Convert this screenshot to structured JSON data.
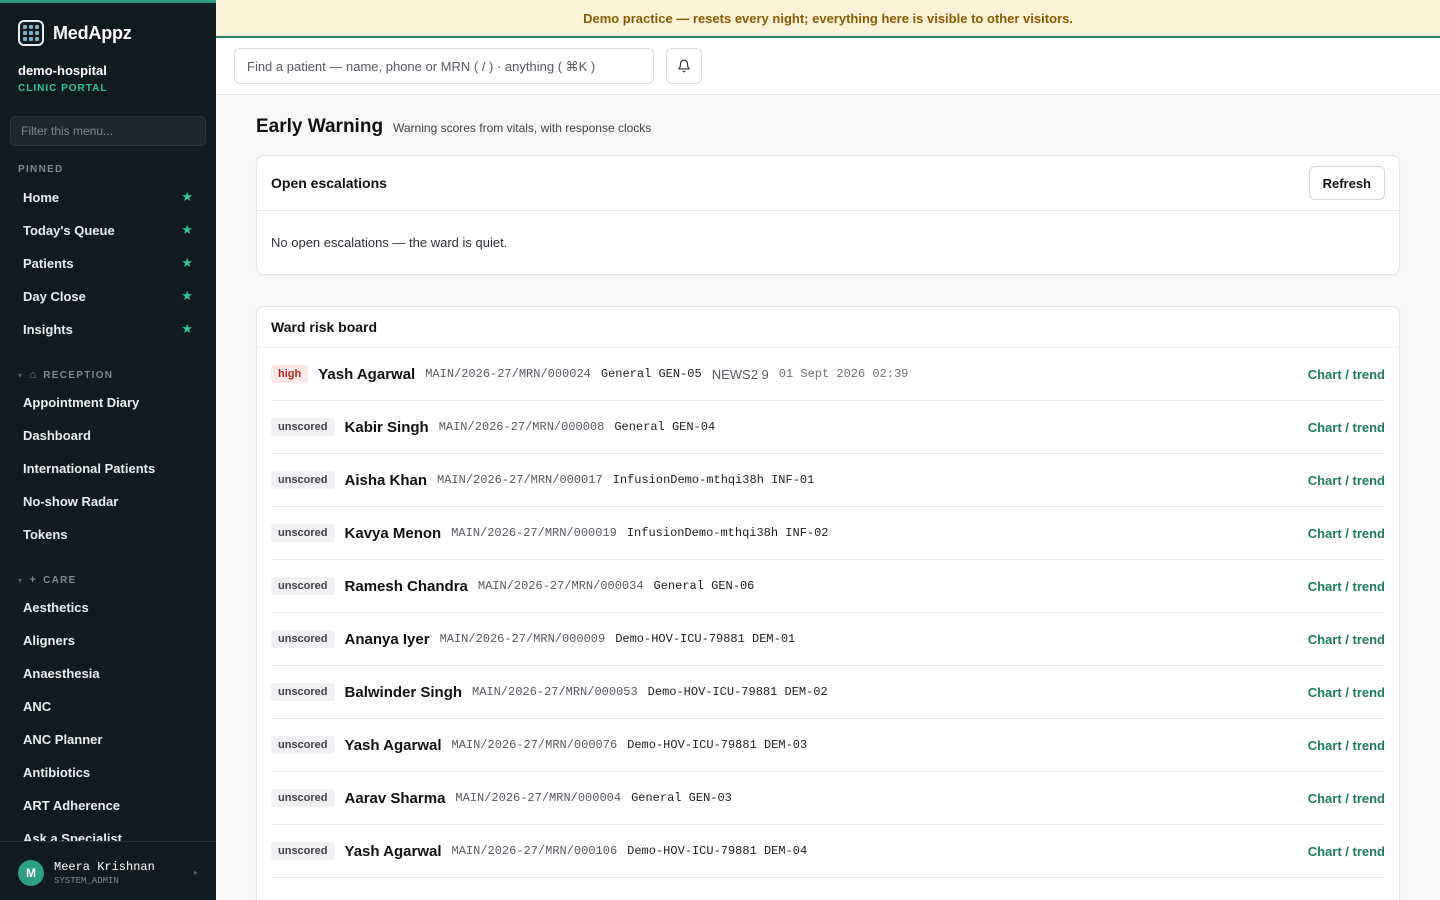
{
  "brand": {
    "name": "MedAppz"
  },
  "tenant": {
    "name": "demo-hospital",
    "subtitle": "CLINIC PORTAL"
  },
  "sidebar": {
    "filter_placeholder": "Filter this menu...",
    "pinned_label": "PINNED",
    "pinned": [
      {
        "label": "Home"
      },
      {
        "label": "Today's Queue"
      },
      {
        "label": "Patients"
      },
      {
        "label": "Day Close"
      },
      {
        "label": "Insights"
      }
    ],
    "reception_label": "RECEPTION",
    "reception": [
      {
        "label": "Appointment Diary"
      },
      {
        "label": "Dashboard"
      },
      {
        "label": "International Patients"
      },
      {
        "label": "No-show Radar"
      },
      {
        "label": "Tokens"
      }
    ],
    "care_label": "CARE",
    "care": [
      {
        "label": "Aesthetics"
      },
      {
        "label": "Aligners"
      },
      {
        "label": "Anaesthesia"
      },
      {
        "label": "ANC"
      },
      {
        "label": "ANC Planner"
      },
      {
        "label": "Antibiotics"
      },
      {
        "label": "ART Adherence"
      },
      {
        "label": "Ask a Specialist"
      }
    ]
  },
  "user": {
    "initial": "M",
    "name": "Meera Krishnan",
    "role": "SYSTEM_ADMIN"
  },
  "banner": {
    "text": "Demo practice — resets every night; everything here is visible to other visitors."
  },
  "topbar": {
    "search_placeholder": "Find a patient — name, phone or MRN ( / ) · anything ( ⌘K )"
  },
  "page": {
    "title": "Early Warning",
    "subtitle": "Warning scores from vitals, with response clocks"
  },
  "escalations": {
    "title": "Open escalations",
    "refresh_label": "Refresh",
    "empty_text": "No open escalations — the ward is quiet."
  },
  "risk_board": {
    "title": "Ward risk board",
    "link_label": "Chart / trend",
    "rows": [
      {
        "level": "high",
        "name": "Yash Agarwal",
        "mrn": "MAIN/2026-27/MRN/000024",
        "location": "General GEN-05",
        "score": "NEWS2 9",
        "time": "01 Sept 2026 02:39"
      },
      {
        "level": "unscored",
        "name": "Kabir Singh",
        "mrn": "MAIN/2026-27/MRN/000008",
        "location": "General GEN-04",
        "score": "",
        "time": ""
      },
      {
        "level": "unscored",
        "name": "Aisha Khan",
        "mrn": "MAIN/2026-27/MRN/000017",
        "location": "InfusionDemo-mthqi38h INF-01",
        "score": "",
        "time": ""
      },
      {
        "level": "unscored",
        "name": "Kavya Menon",
        "mrn": "MAIN/2026-27/MRN/000019",
        "location": "InfusionDemo-mthqi38h INF-02",
        "score": "",
        "time": ""
      },
      {
        "level": "unscored",
        "name": "Ramesh Chandra",
        "mrn": "MAIN/2026-27/MRN/000034",
        "location": "General GEN-06",
        "score": "",
        "time": ""
      },
      {
        "level": "unscored",
        "name": "Ananya Iyer",
        "mrn": "MAIN/2026-27/MRN/000009",
        "location": "Demo-HOV-ICU-79881 DEM-01",
        "score": "",
        "time": ""
      },
      {
        "level": "unscored",
        "name": "Balwinder Singh",
        "mrn": "MAIN/2026-27/MRN/000053",
        "location": "Demo-HOV-ICU-79881 DEM-02",
        "score": "",
        "time": ""
      },
      {
        "level": "unscored",
        "name": "Yash Agarwal",
        "mrn": "MAIN/2026-27/MRN/000076",
        "location": "Demo-HOV-ICU-79881 DEM-03",
        "score": "",
        "time": ""
      },
      {
        "level": "unscored",
        "name": "Aarav Sharma",
        "mrn": "MAIN/2026-27/MRN/000004",
        "location": "General GEN-03",
        "score": "",
        "time": ""
      },
      {
        "level": "unscored",
        "name": "Yash Agarwal",
        "mrn": "MAIN/2026-27/MRN/000106",
        "location": "Demo-HOV-ICU-79881 DEM-04",
        "score": "",
        "time": ""
      }
    ]
  }
}
